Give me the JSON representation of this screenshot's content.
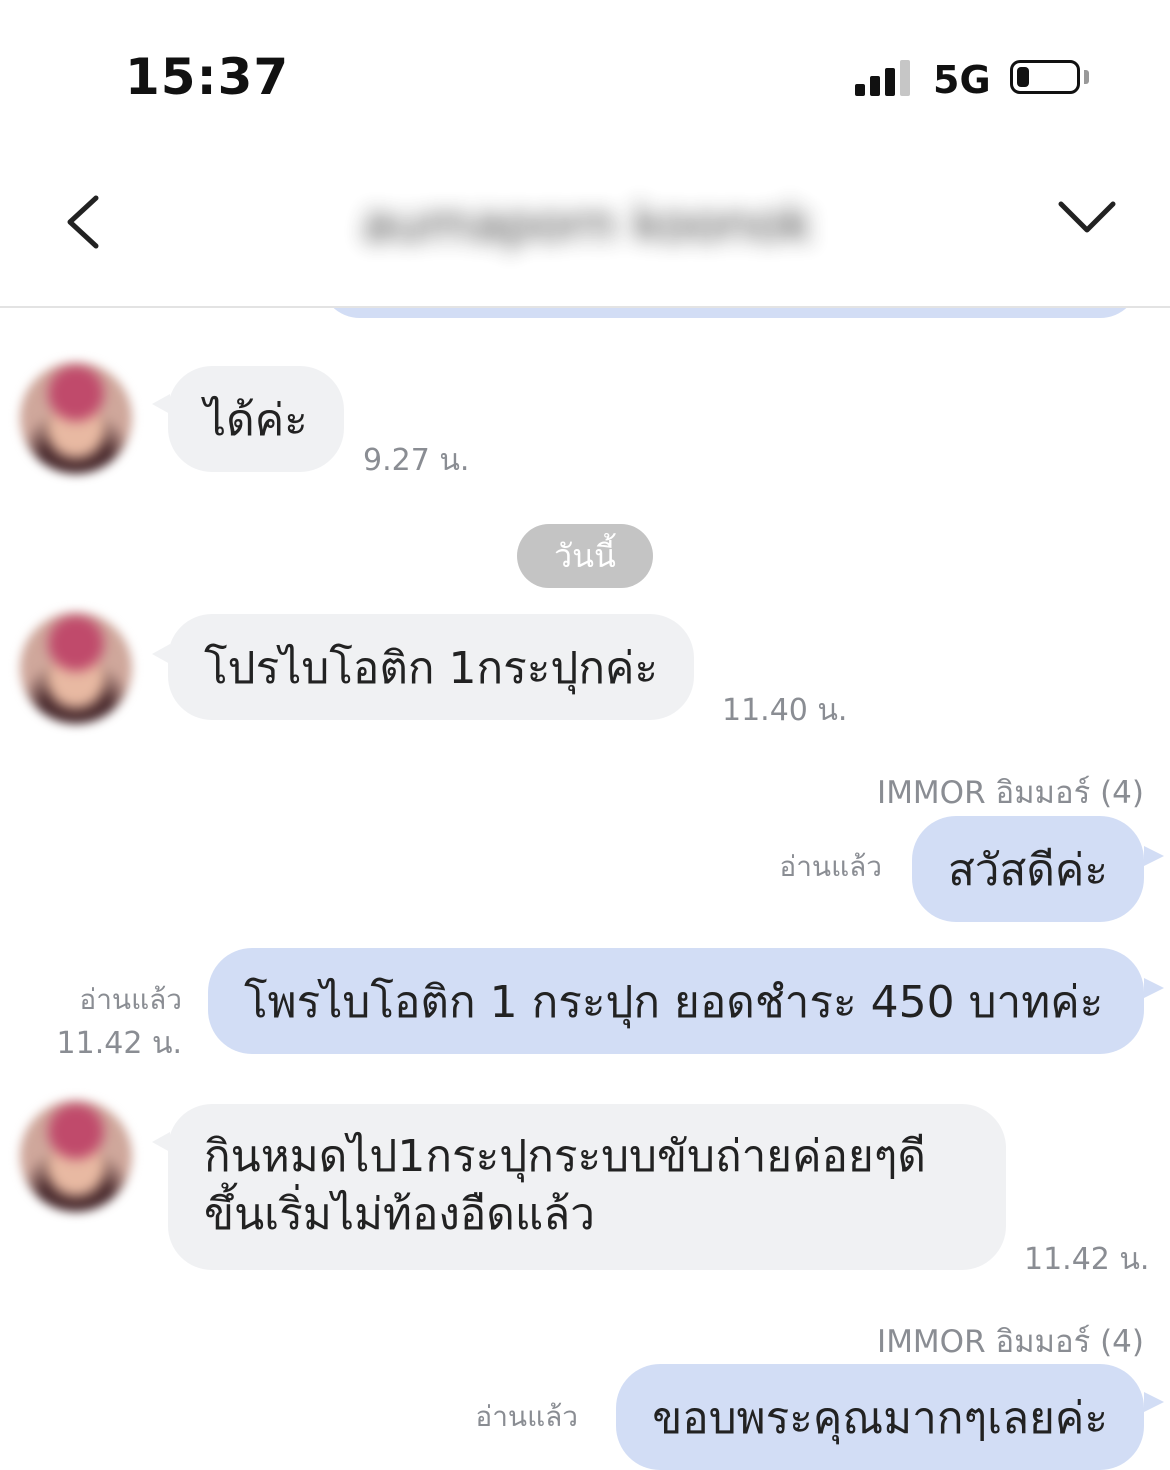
{
  "status_bar": {
    "time": "15:37",
    "network": "5G",
    "battery_level": 0.2
  },
  "header": {
    "contact_name": "aumaporn koonok"
  },
  "day_separator": "วันนี้",
  "messages": [
    {
      "direction": "incoming",
      "text": "ได้ค่ะ",
      "time": "9.27 น."
    },
    {
      "direction": "incoming",
      "text": "โปรไบโอติก 1กระปุกค่ะ",
      "time": "11.40 น."
    },
    {
      "direction": "outgoing",
      "sender": "IMMOR อิมมอร์ (4)",
      "text": "สวัสดีค่ะ",
      "read": "อ่านแล้ว"
    },
    {
      "direction": "outgoing",
      "text": "โพรไบโอติก 1 กระปุก ยอดชำระ 450 บาทค่ะ",
      "read": "อ่านแล้ว",
      "time": "11.42 น."
    },
    {
      "direction": "incoming",
      "text_lines": [
        "กินหมดไป1กระปุกระบบขับถ่ายค่อยๆดี",
        "ขึ้นเริ่มไม่ท้องอืดแล้ว"
      ],
      "time": "11.42 น."
    },
    {
      "direction": "outgoing",
      "sender": "IMMOR อิมมอร์ (4)",
      "text": "ขอบพระคุณมากๆเลยค่ะ",
      "read": "อ่านแล้ว"
    }
  ]
}
